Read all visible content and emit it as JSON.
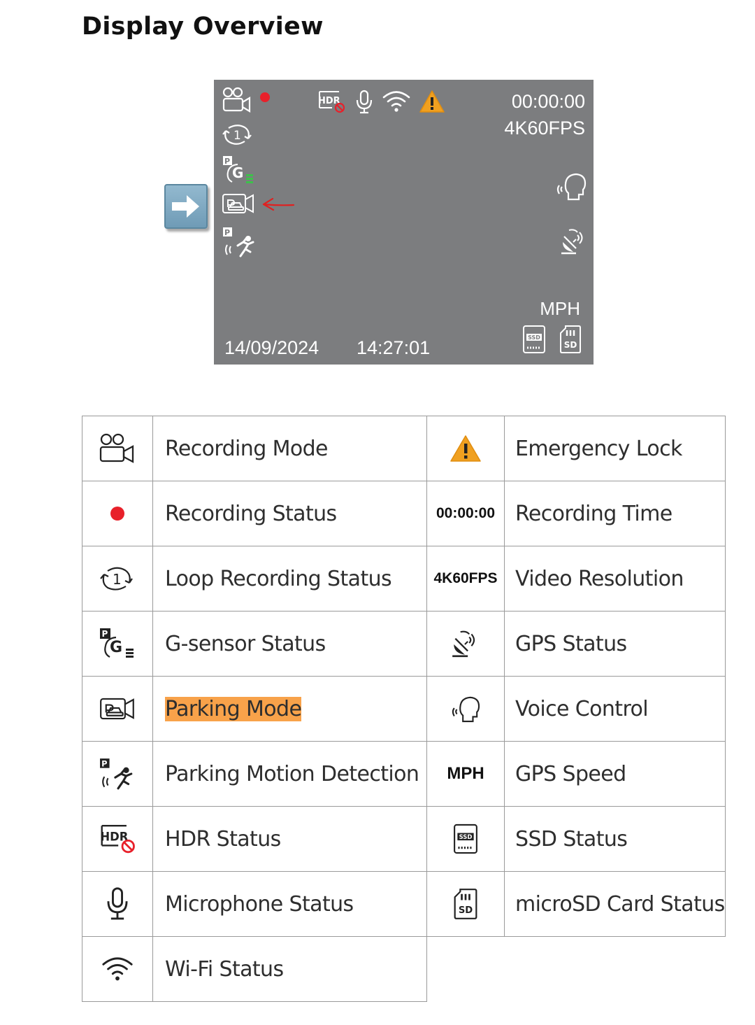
{
  "page_title": "Display Overview",
  "screen": {
    "recording_time": "00:00:00",
    "video_resolution": "4K60FPS",
    "speed_unit": "MPH",
    "date": "14/09/2024",
    "time": "14:27:01",
    "hdr_icon_text": "HDR",
    "ssd_icon_text": "SSD",
    "sd_icon_text": "SD",
    "sensor_p_text": "P",
    "sensor_g_text": "G",
    "colors": {
      "background": "#7c7d7f",
      "recording_dot": "#e8202a",
      "warning": "#f0a020",
      "annotation_arrow": "#e02020"
    }
  },
  "legend": {
    "left": [
      {
        "icon": "recording-mode-icon",
        "label": "Recording Mode"
      },
      {
        "icon": "recording-status-icon",
        "label": "Recording Status"
      },
      {
        "icon": "loop-recording-icon",
        "label": "Loop Recording Status"
      },
      {
        "icon": "g-sensor-icon",
        "label": "G-sensor Status"
      },
      {
        "icon": "parking-mode-icon",
        "label": "Parking Mode",
        "highlighted": true
      },
      {
        "icon": "parking-motion-icon",
        "label": "Parking Motion Detection"
      },
      {
        "icon": "hdr-icon",
        "label": "HDR Status"
      },
      {
        "icon": "microphone-icon",
        "label": "Microphone Status"
      },
      {
        "icon": "wifi-icon",
        "label": "Wi-Fi Status"
      }
    ],
    "right": [
      {
        "icon": "warning-icon",
        "label": "Emergency Lock"
      },
      {
        "code": "00:00:00",
        "label": "Recording Time"
      },
      {
        "code": "4K60FPS",
        "label": "Video Resolution"
      },
      {
        "icon": "gps-satellite-icon",
        "label": "GPS Status"
      },
      {
        "icon": "voice-control-icon",
        "label": "Voice Control"
      },
      {
        "code": "MPH",
        "label": "GPS Speed"
      },
      {
        "icon": "ssd-icon",
        "label": "SSD Status"
      },
      {
        "icon": "microsd-icon",
        "label": "microSD Card Status"
      }
    ]
  }
}
